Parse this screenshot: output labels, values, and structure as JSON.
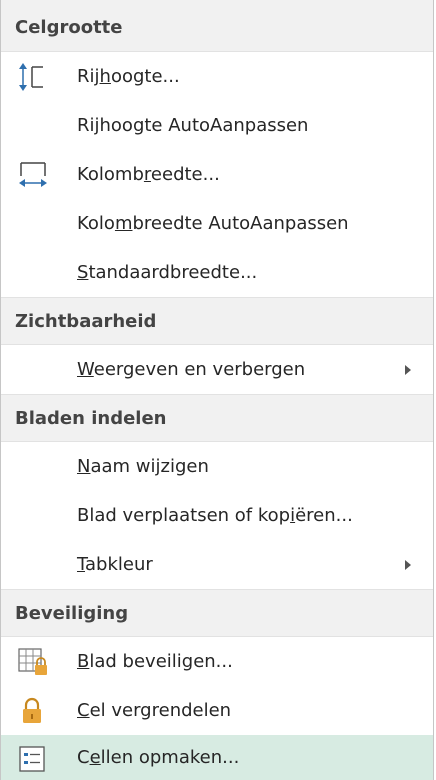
{
  "menu": {
    "section_celgrootte": "Celgrootte",
    "row_height": [
      "Rij",
      "h",
      "oogte..."
    ],
    "row_height_auto": "Rijhoogte AutoAanpassen",
    "col_width": [
      "Kolomb",
      "r",
      "eedte..."
    ],
    "col_width_auto": [
      "Kolo",
      "m",
      "breedte AutoAanpassen"
    ],
    "default_width": [
      "",
      "S",
      "tandaardbreedte..."
    ],
    "section_visibility": "Zichtbaarheid",
    "show_hide": [
      "",
      "W",
      "eergeven en verbergen"
    ],
    "section_sheets": "Bladen indelen",
    "rename": [
      "",
      "N",
      "aam wijzigen"
    ],
    "move_copy": [
      "Blad verplaatsen of kop",
      "i",
      "ëren..."
    ],
    "tab_color": [
      "",
      "T",
      "abkleur"
    ],
    "section_protection": "Beveiliging",
    "protect_sheet": [
      "",
      "B",
      "lad beveiligen..."
    ],
    "lock_cell": [
      "",
      "C",
      "el vergrendelen"
    ],
    "format_cells": [
      "C",
      "e",
      "llen opmaken..."
    ]
  },
  "icons": {
    "row_height": "row-height-icon",
    "col_width": "column-width-icon",
    "protect_sheet": "protect-sheet-icon",
    "lock_cell": "lock-icon",
    "format_cells": "format-cells-icon"
  },
  "colors": {
    "highlight": "#d7ebe2",
    "header_bg": "#f1f1f1",
    "lock": "#e8a53a"
  }
}
